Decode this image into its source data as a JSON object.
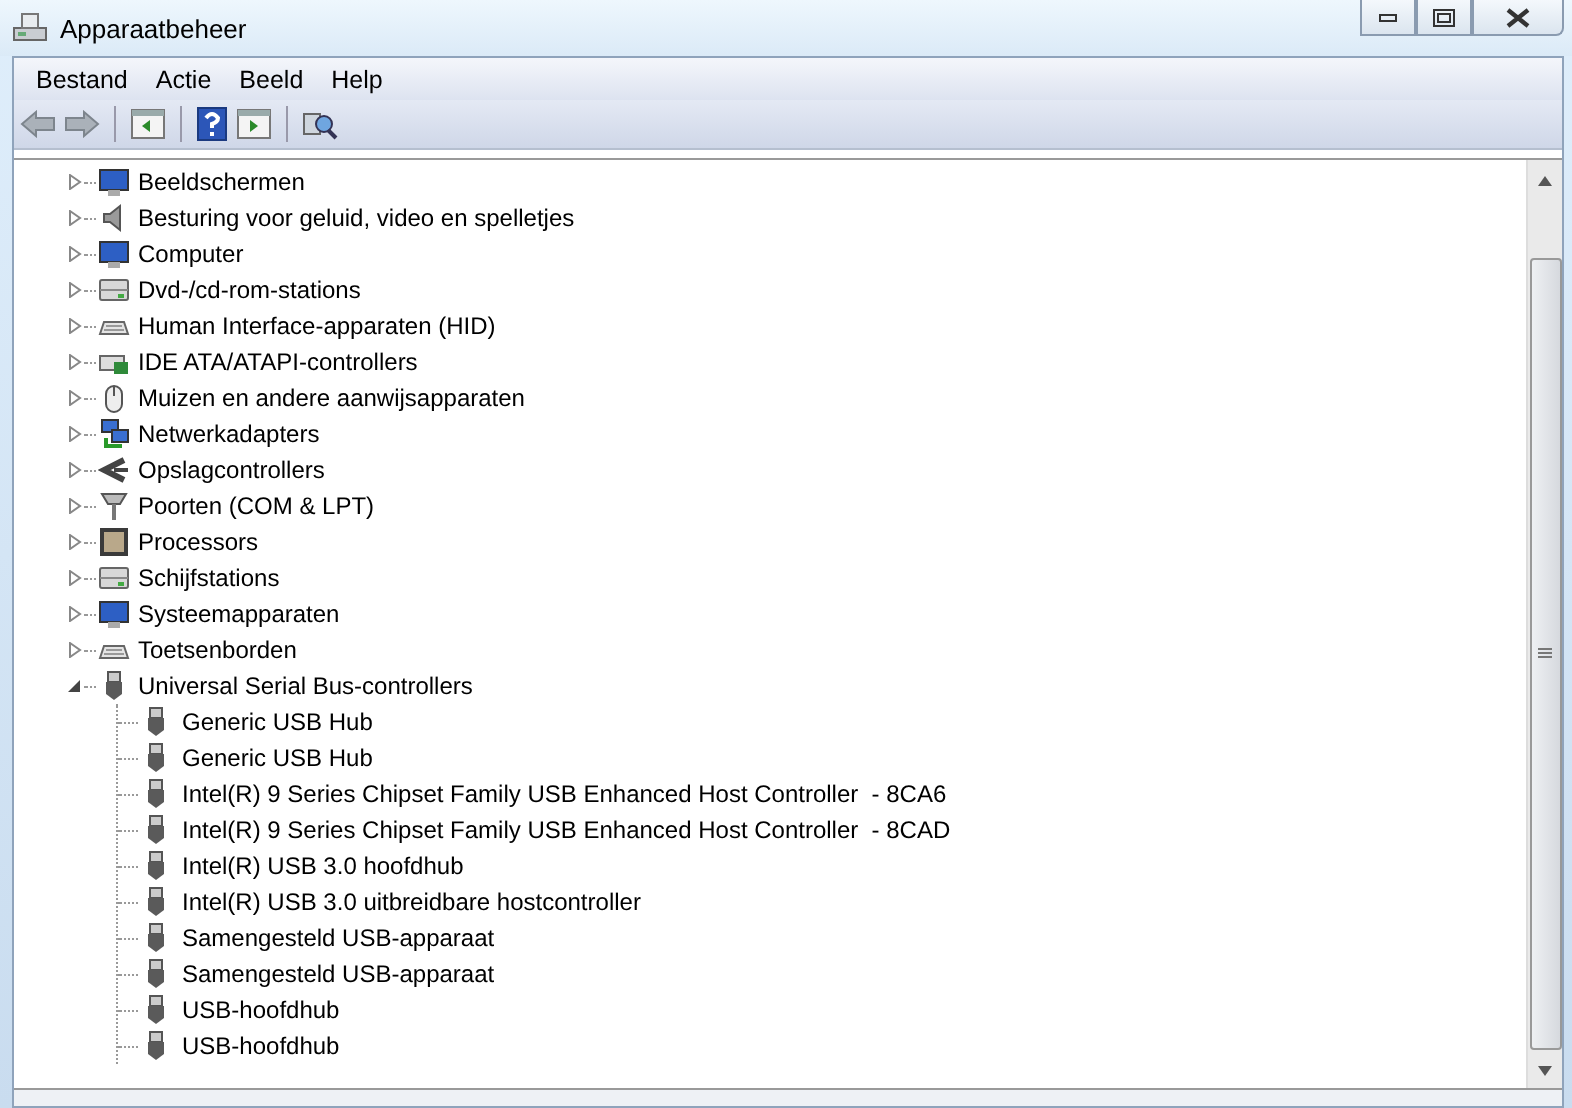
{
  "window": {
    "title": "Apparaatbeheer"
  },
  "menu": [
    "Bestand",
    "Actie",
    "Beeld",
    "Help"
  ],
  "tree": [
    {
      "label": "Beeldschermen",
      "expanded": false
    },
    {
      "label": "Besturing voor geluid, video en spelletjes",
      "expanded": false
    },
    {
      "label": "Computer",
      "expanded": false
    },
    {
      "label": "Dvd-/cd-rom-stations",
      "expanded": false
    },
    {
      "label": "Human Interface-apparaten (HID)",
      "expanded": false
    },
    {
      "label": "IDE ATA/ATAPI-controllers",
      "expanded": false
    },
    {
      "label": "Muizen en andere aanwijsapparaten",
      "expanded": false
    },
    {
      "label": "Netwerkadapters",
      "expanded": false
    },
    {
      "label": "Opslagcontrollers",
      "expanded": false
    },
    {
      "label": "Poorten (COM & LPT)",
      "expanded": false
    },
    {
      "label": "Processors",
      "expanded": false
    },
    {
      "label": "Schijfstations",
      "expanded": false
    },
    {
      "label": "Systeemapparaten",
      "expanded": false
    },
    {
      "label": "Toetsenborden",
      "expanded": false
    },
    {
      "label": "Universal Serial Bus-controllers",
      "expanded": true,
      "children": [
        {
          "label": "Generic USB Hub"
        },
        {
          "label": "Generic USB Hub"
        },
        {
          "label": "Intel(R) 9 Series Chipset Family USB Enhanced Host Controller  - 8CA6"
        },
        {
          "label": "Intel(R) 9 Series Chipset Family USB Enhanced Host Controller  - 8CAD"
        },
        {
          "label": "Intel(R) USB 3.0 hoofdhub"
        },
        {
          "label": "Intel(R) USB 3.0 uitbreidbare hostcontroller"
        },
        {
          "label": "Samengesteld USB-apparaat"
        },
        {
          "label": "Samengesteld USB-apparaat"
        },
        {
          "label": "USB-hoofdhub"
        },
        {
          "label": "USB-hoofdhub"
        }
      ]
    }
  ]
}
